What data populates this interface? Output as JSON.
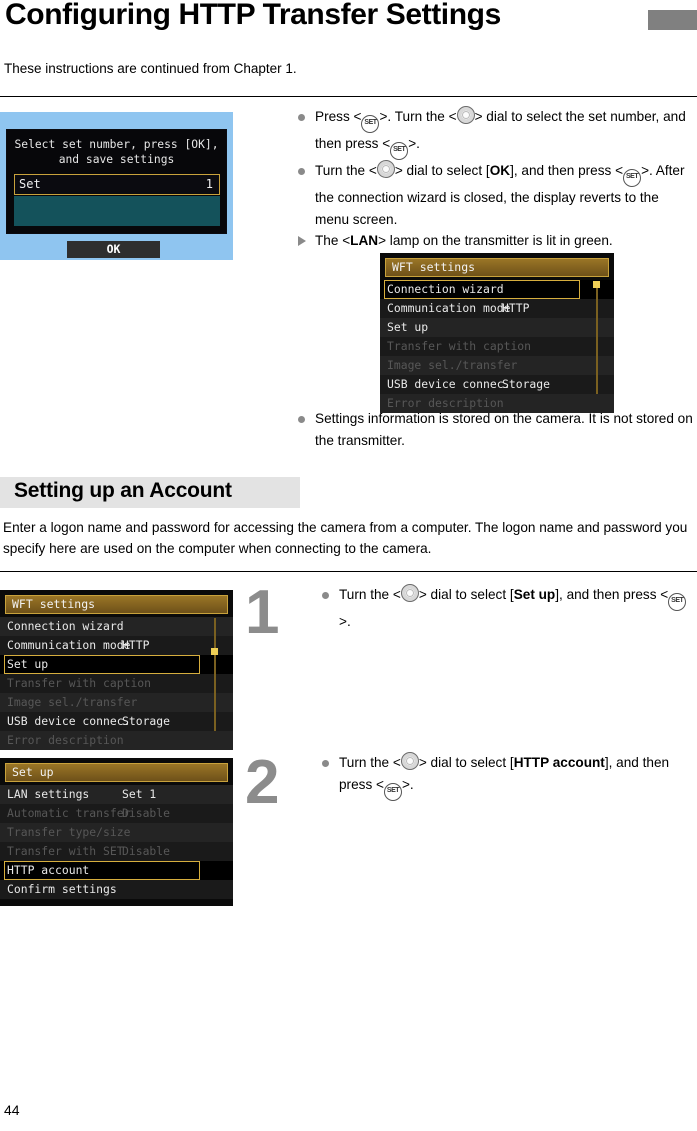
{
  "page": {
    "title": "Configuring HTTP Transfer Settings",
    "intro": "These instructions are continued from Chapter 1.",
    "number": "44"
  },
  "icons": {
    "set": "SET",
    "dial": "quick-control-dial"
  },
  "top_block": {
    "bullets": [
      {
        "marker": "dot",
        "segments": [
          {
            "t": "Press <"
          },
          {
            "icon": "set"
          },
          {
            "t": ">. Turn the <"
          },
          {
            "icon": "dial"
          },
          {
            "t": "> dial to select the set number, and then press <"
          },
          {
            "icon": "set"
          },
          {
            "t": ">."
          }
        ]
      },
      {
        "marker": "dot",
        "segments": [
          {
            "t": "Turn the <"
          },
          {
            "icon": "dial"
          },
          {
            "t": "> dial to select ["
          },
          {
            "t": "OK",
            "bold": true
          },
          {
            "t": "], and then press <"
          },
          {
            "icon": "set"
          },
          {
            "t": ">. After the connection wizard is closed, the display reverts to the menu screen."
          }
        ]
      },
      {
        "marker": "triangle",
        "segments": [
          {
            "t": "The <"
          },
          {
            "t": "LAN",
            "bold": true
          },
          {
            "t": "> lamp on the transmitter is lit in green."
          }
        ]
      }
    ],
    "note_bullet": {
      "marker": "dot",
      "segments": [
        {
          "t": "Settings information is stored on the camera. It is not stored on the transmitter."
        }
      ]
    }
  },
  "section": {
    "heading": "Setting up an Account",
    "body": "Enter a logon name and password for accessing the camera from a computer. The logon name and password you specify here are used on the computer when connecting to the camera."
  },
  "steps": [
    {
      "number": "1",
      "marker": "dot",
      "segments": [
        {
          "t": "Turn the <"
        },
        {
          "icon": "dial"
        },
        {
          "t": "> dial to select ["
        },
        {
          "t": "Set up",
          "bold": true
        },
        {
          "t": "], and then press <"
        },
        {
          "icon": "set"
        },
        {
          "t": ">."
        }
      ]
    },
    {
      "number": "2",
      "marker": "dot",
      "segments": [
        {
          "t": "Turn the <"
        },
        {
          "icon": "dial"
        },
        {
          "t": "> dial to select ["
        },
        {
          "t": "HTTP account",
          "bold": true
        },
        {
          "t": "], and then press <"
        },
        {
          "icon": "set"
        },
        {
          "t": ">."
        }
      ]
    }
  ],
  "screenshot_a": {
    "prompt_line1": "Select set number, press [OK],",
    "prompt_line2": "and save settings",
    "set_label": "Set",
    "set_value": "1",
    "ok_label": "OK",
    "bg_color": "#8fc5f0"
  },
  "screenshot_b": {
    "header": "WFT settings",
    "rows": [
      {
        "label": "Connection wizard",
        "value": "",
        "dim": false,
        "selected": true
      },
      {
        "label": "Communication mode",
        "value": "HTTP",
        "dim": false,
        "selected": false
      },
      {
        "label": "Set up",
        "value": "",
        "dim": false,
        "selected": false
      },
      {
        "label": "Transfer with caption",
        "value": "",
        "dim": true,
        "selected": false
      },
      {
        "label": "Image sel./transfer",
        "value": "",
        "dim": true,
        "selected": false
      },
      {
        "label": "USB device connec.",
        "value": "Storage",
        "dim": false,
        "selected": false
      },
      {
        "label": "Error description",
        "value": "",
        "dim": true,
        "selected": false
      }
    ]
  },
  "screenshot_c": {
    "header": "WFT settings",
    "rows": [
      {
        "label": "Connection wizard",
        "value": "",
        "dim": false,
        "selected": false
      },
      {
        "label": "Communication mode",
        "value": "HTTP",
        "dim": false,
        "selected": false
      },
      {
        "label": "Set up",
        "value": "",
        "dim": false,
        "selected": true
      },
      {
        "label": "Transfer with caption",
        "value": "",
        "dim": true,
        "selected": false
      },
      {
        "label": "Image sel./transfer",
        "value": "",
        "dim": true,
        "selected": false
      },
      {
        "label": "USB device connec.",
        "value": "Storage",
        "dim": false,
        "selected": false
      },
      {
        "label": "Error description",
        "value": "",
        "dim": true,
        "selected": false
      }
    ]
  },
  "screenshot_d": {
    "header": "Set up",
    "rows": [
      {
        "label": "LAN settings",
        "value": "Set 1",
        "dim": false,
        "selected": false
      },
      {
        "label": "Automatic transfer",
        "value": "Disable",
        "dim": true,
        "selected": false
      },
      {
        "label": "Transfer type/size",
        "value": "",
        "dim": true,
        "selected": false
      },
      {
        "label": "Transfer with SET",
        "value": "Disable",
        "dim": true,
        "selected": false
      },
      {
        "label": "HTTP account",
        "value": "",
        "dim": false,
        "selected": true
      },
      {
        "label": "Confirm settings",
        "value": "",
        "dim": false,
        "selected": false
      }
    ]
  }
}
